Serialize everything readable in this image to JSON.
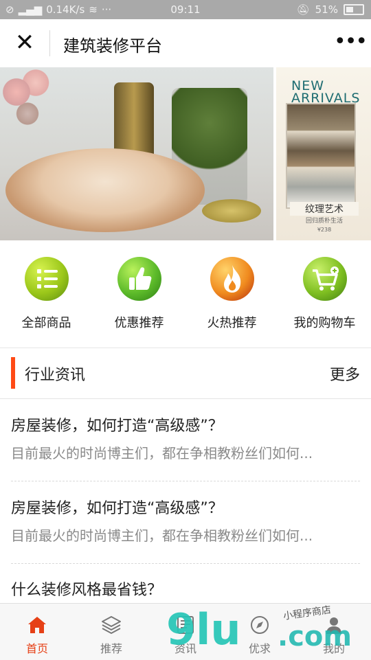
{
  "status_bar": {
    "network_speed": "0.14K/s",
    "time": "09:11",
    "battery": "51%",
    "overflow": "···"
  },
  "nav": {
    "title": "建筑装修平台",
    "close_symbol": "✕",
    "more_symbol": "•••"
  },
  "banner": {
    "side_headline": "NEW ARRIVALS",
    "side_caption": "纹理艺术",
    "side_subcaption": "回归质朴生活",
    "side_price": "¥238",
    "slides_total": 3,
    "active_slide": 3
  },
  "categories": [
    {
      "label": "全部商品",
      "icon": "list-icon"
    },
    {
      "label": "优惠推荐",
      "icon": "thumbs-up-icon"
    },
    {
      "label": "火热推荐",
      "icon": "flame-icon"
    },
    {
      "label": "我的购物车",
      "icon": "cart-icon"
    }
  ],
  "news": {
    "section_title": "行业资讯",
    "more_label": "更多",
    "articles": [
      {
        "title": "房屋装修，如何打造“高级感”？",
        "excerpt": "目前最火的时尚博主们，都在争相教粉丝们如何..."
      },
      {
        "title": "房屋装修，如何打造“高级感”？",
        "excerpt": "目前最火的时尚博主们，都在争相教粉丝们如何..."
      },
      {
        "title": "什么装修风格最省钱？",
        "excerpt": ""
      }
    ]
  },
  "tabbar": {
    "items": [
      {
        "label": "首页",
        "icon": "home-icon",
        "active": true
      },
      {
        "label": "推荐",
        "icon": "layers-icon",
        "active": false
      },
      {
        "label": "资讯",
        "icon": "news-icon",
        "active": false
      },
      {
        "label": "优求",
        "icon": "compass-icon",
        "active": false
      },
      {
        "label": "我的",
        "icon": "user-icon",
        "active": false
      }
    ]
  },
  "watermark": {
    "main": "9lu",
    "suffix": ".com",
    "script": "小程序商店"
  },
  "colors": {
    "accent": "#ff4a16",
    "tab_active": "#e64016",
    "statusbar": "#a9a9a9"
  }
}
